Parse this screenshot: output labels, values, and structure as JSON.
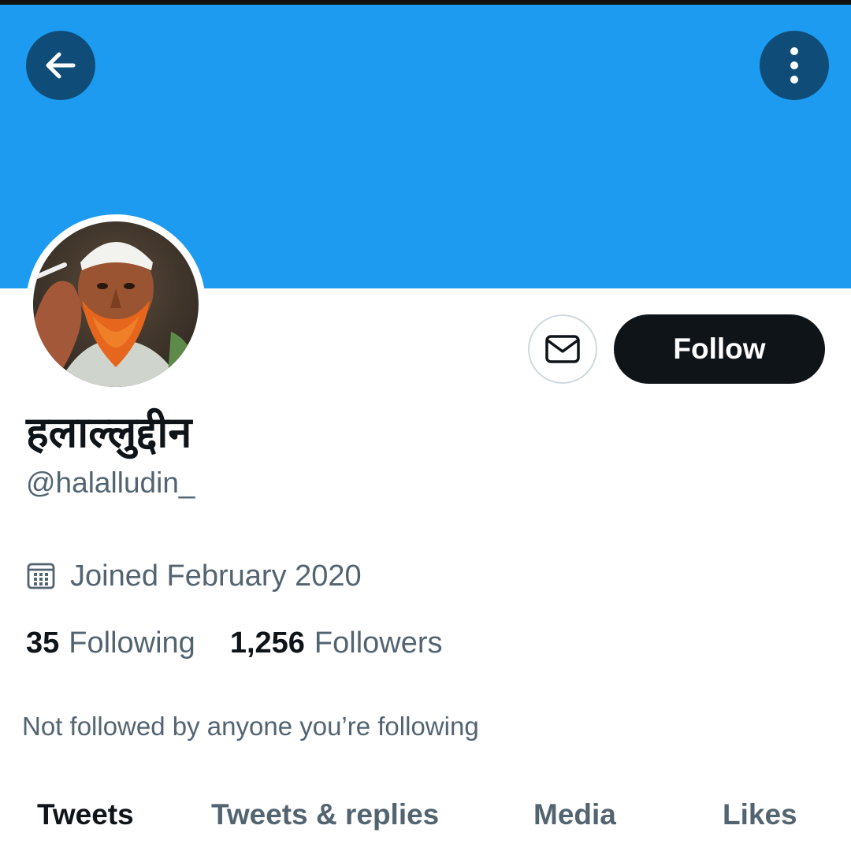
{
  "profile": {
    "display_name": "हलाल्लुद्दीन",
    "handle": "@halalludin_",
    "joined": "Joined February 2020",
    "following_count": "35",
    "following_label": "Following",
    "followers_count": "1,256",
    "followers_label": "Followers",
    "mutuals_note": "Not followed by anyone you’re following"
  },
  "actions": {
    "follow_label": "Follow"
  },
  "tabs": [
    {
      "label": "Tweets",
      "active": true
    },
    {
      "label": "Tweets & replies",
      "active": false
    },
    {
      "label": "Media",
      "active": false
    },
    {
      "label": "Likes",
      "active": false
    }
  ],
  "icons": {
    "back": "arrow-left-icon",
    "more": "vertical-dots-icon",
    "message": "envelope-icon",
    "calendar": "calendar-icon"
  },
  "colors": {
    "banner": "#1d9bf0",
    "header_button": "#0f4d78",
    "primary_text": "#0f1419",
    "secondary_text": "#536471",
    "follow_button": "#0f1419"
  }
}
